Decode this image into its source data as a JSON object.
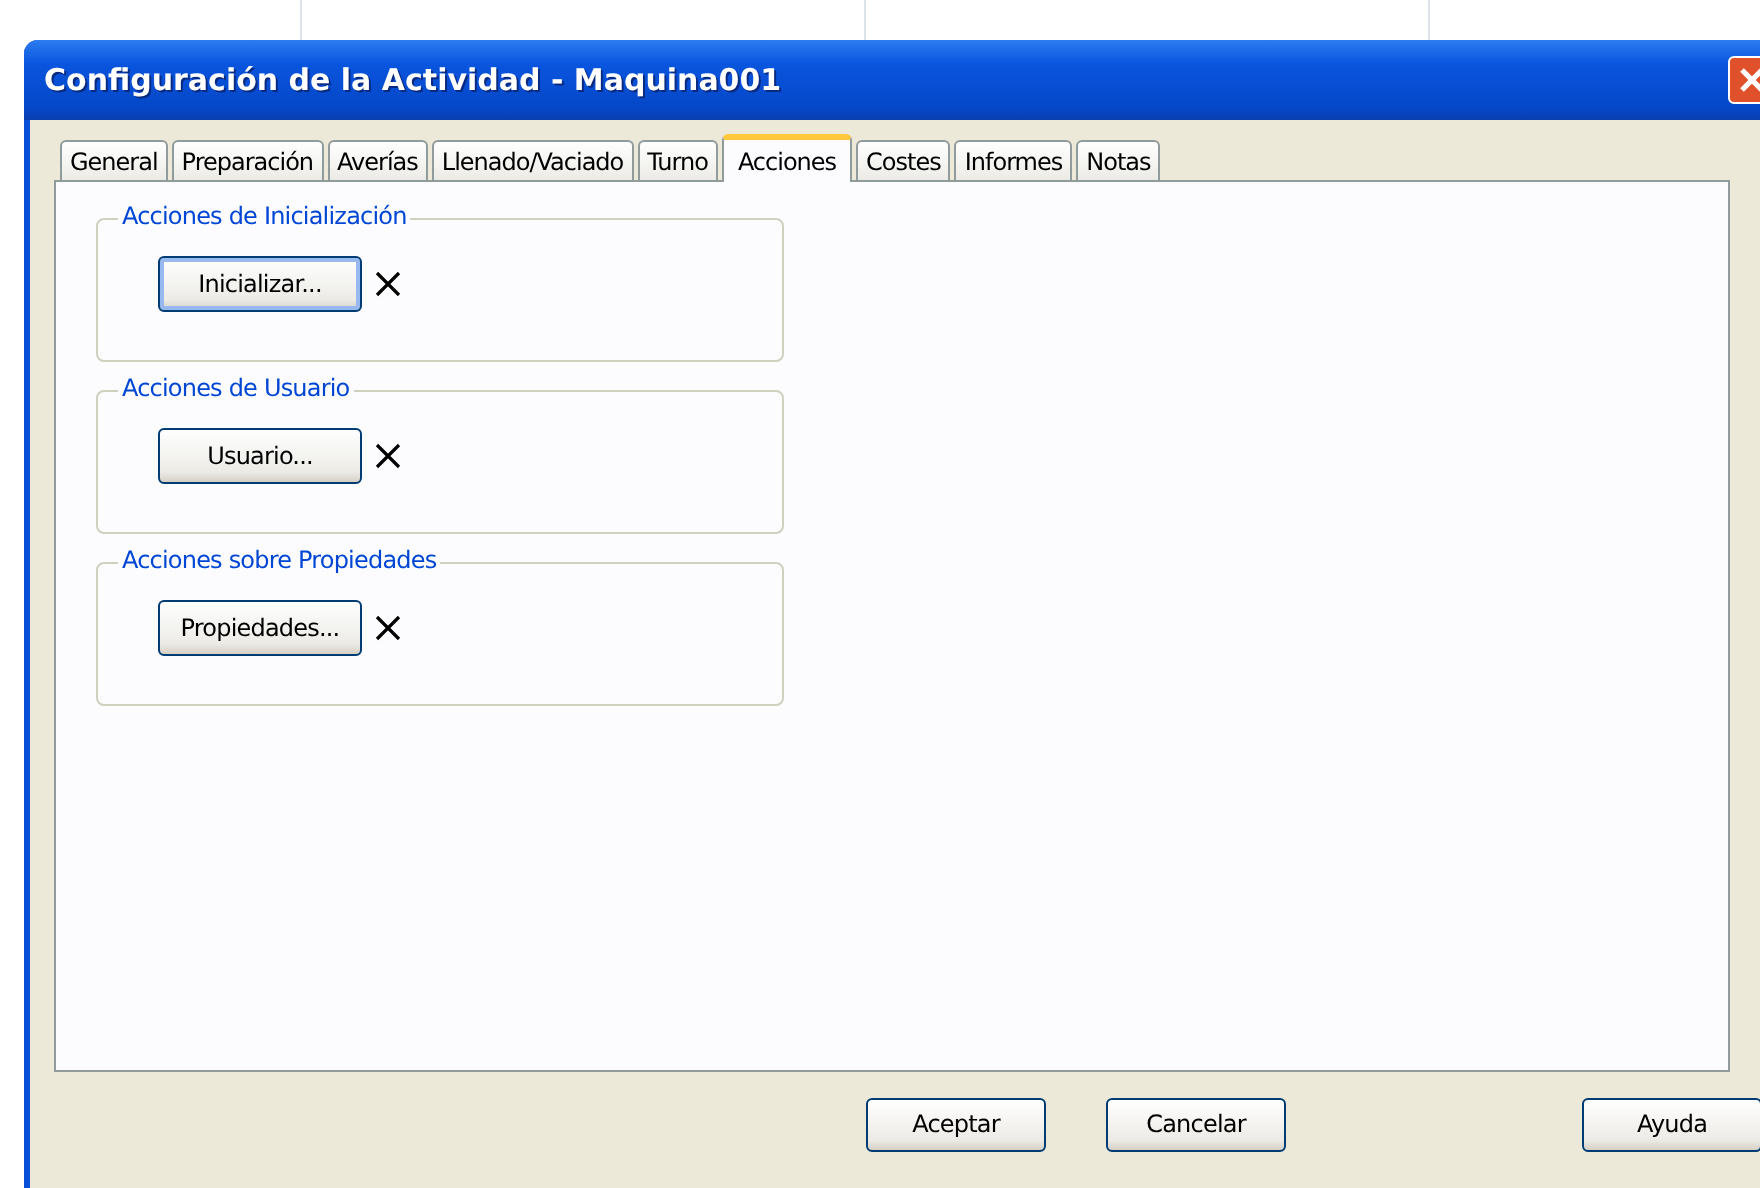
{
  "window": {
    "title": "Configuración de la Actividad - Maquina001"
  },
  "tabs": [
    {
      "label": "General",
      "selected": false
    },
    {
      "label": "Preparación",
      "selected": false
    },
    {
      "label": "Averías",
      "selected": false
    },
    {
      "label": "Llenado/Vaciado",
      "selected": false
    },
    {
      "label": "Turno",
      "selected": false
    },
    {
      "label": "Acciones",
      "selected": true
    },
    {
      "label": "Costes",
      "selected": false
    },
    {
      "label": "Informes",
      "selected": false
    },
    {
      "label": "Notas",
      "selected": false
    }
  ],
  "groups": [
    {
      "title": "Acciones de Inicialización",
      "button": "Inicializar...",
      "focused": true
    },
    {
      "title": "Acciones de Usuario",
      "button": "Usuario...",
      "focused": false
    },
    {
      "title": "Acciones sobre Propiedades",
      "button": "Propiedades...",
      "focused": false
    }
  ],
  "buttons": [
    "Aceptar",
    "Cancelar",
    "Ayuda"
  ]
}
